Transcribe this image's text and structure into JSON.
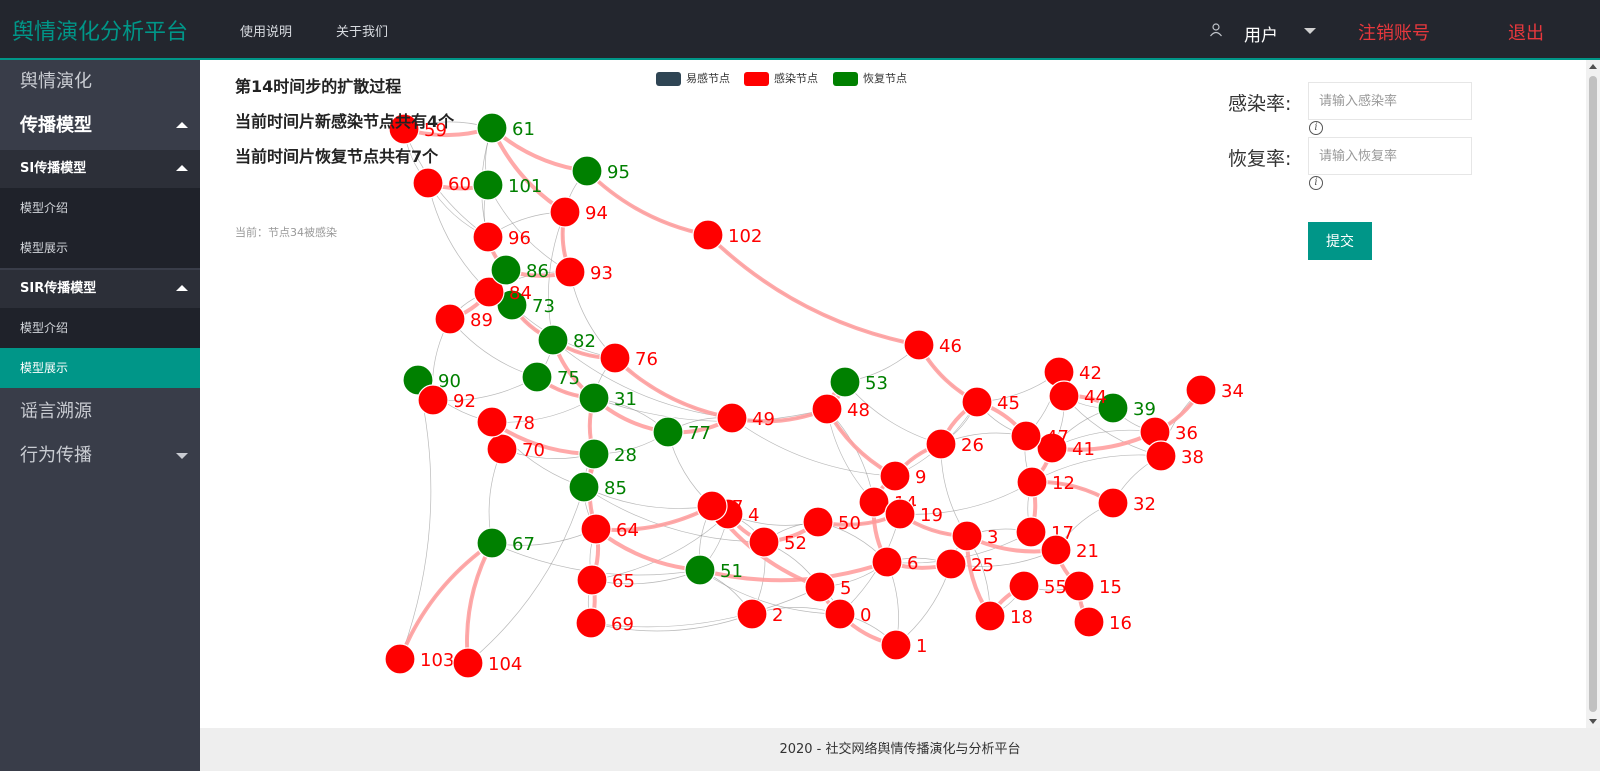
{
  "app": {
    "title": "舆情演化分析平台",
    "nav": [
      "使用说明",
      "关于我们"
    ],
    "user_label": "用户",
    "logout_account": "注销账号",
    "exit": "退出"
  },
  "sidebar": {
    "items": [
      {
        "label": "舆情演化"
      },
      {
        "label": "传播模型"
      },
      {
        "label": "SI传播模型"
      },
      {
        "label": "模型介绍"
      },
      {
        "label": "模型展示"
      },
      {
        "label": "SIR传播模型"
      },
      {
        "label": "模型介绍"
      },
      {
        "label": "模型展示"
      },
      {
        "label": "谣言溯源"
      },
      {
        "label": "行为传播"
      }
    ]
  },
  "main": {
    "step_text": "第14时间步的扩散过程",
    "new_infected_text": "当前时间片新感染节点共有4个",
    "new_recovered_text": "当前时间片恢复节点共有7个",
    "current_text": "当前：节点34被感染",
    "legend": [
      {
        "label": "易感节点",
        "color": "#2f4554"
      },
      {
        "label": "感染节点",
        "color": "#ff0000"
      },
      {
        "label": "恢复节点",
        "color": "#008000"
      }
    ],
    "form": {
      "infect_label": "感染率:",
      "infect_placeholder": "请输入感染率",
      "recover_label": "恢复率:",
      "recover_placeholder": "请输入恢复率",
      "submit_label": "提交"
    }
  },
  "footer": {
    "text": "2020 - 社交网络舆情传播演化与分析平台"
  },
  "colors": {
    "accent": "#009688",
    "infected": "#ff0000",
    "recovered": "#008000",
    "danger": "#e8383d"
  },
  "chart_data": {
    "type": "network",
    "nodes": [
      {
        "id": "0",
        "state": "infected"
      },
      {
        "id": "1",
        "state": "infected"
      },
      {
        "id": "2",
        "state": "infected"
      },
      {
        "id": "3",
        "state": "infected"
      },
      {
        "id": "4",
        "state": "infected"
      },
      {
        "id": "5",
        "state": "infected"
      },
      {
        "id": "6",
        "state": "infected"
      },
      {
        "id": "7",
        "state": "infected"
      },
      {
        "id": "9",
        "state": "infected"
      },
      {
        "id": "12",
        "state": "infected"
      },
      {
        "id": "14",
        "state": "infected"
      },
      {
        "id": "15",
        "state": "infected"
      },
      {
        "id": "16",
        "state": "infected"
      },
      {
        "id": "17",
        "state": "infected"
      },
      {
        "id": "18",
        "state": "infected"
      },
      {
        "id": "19",
        "state": "infected"
      },
      {
        "id": "21",
        "state": "infected"
      },
      {
        "id": "25",
        "state": "infected"
      },
      {
        "id": "26",
        "state": "infected"
      },
      {
        "id": "28",
        "state": "recovered"
      },
      {
        "id": "31",
        "state": "recovered"
      },
      {
        "id": "32",
        "state": "infected"
      },
      {
        "id": "34",
        "state": "infected"
      },
      {
        "id": "36",
        "state": "infected"
      },
      {
        "id": "38",
        "state": "infected"
      },
      {
        "id": "39",
        "state": "recovered"
      },
      {
        "id": "41",
        "state": "infected"
      },
      {
        "id": "42",
        "state": "infected"
      },
      {
        "id": "44",
        "state": "infected"
      },
      {
        "id": "45",
        "state": "infected"
      },
      {
        "id": "46",
        "state": "infected"
      },
      {
        "id": "47",
        "state": "infected"
      },
      {
        "id": "48",
        "state": "infected"
      },
      {
        "id": "49",
        "state": "infected"
      },
      {
        "id": "50",
        "state": "infected"
      },
      {
        "id": "51",
        "state": "recovered"
      },
      {
        "id": "52",
        "state": "infected"
      },
      {
        "id": "53",
        "state": "recovered"
      },
      {
        "id": "55",
        "state": "infected"
      },
      {
        "id": "59",
        "state": "infected"
      },
      {
        "id": "60",
        "state": "infected"
      },
      {
        "id": "61",
        "state": "recovered"
      },
      {
        "id": "64",
        "state": "infected"
      },
      {
        "id": "65",
        "state": "infected"
      },
      {
        "id": "67",
        "state": "recovered"
      },
      {
        "id": "69",
        "state": "infected"
      },
      {
        "id": "70",
        "state": "infected"
      },
      {
        "id": "73",
        "state": "recovered"
      },
      {
        "id": "75",
        "state": "recovered"
      },
      {
        "id": "76",
        "state": "infected"
      },
      {
        "id": "77",
        "state": "recovered"
      },
      {
        "id": "78",
        "state": "infected"
      },
      {
        "id": "82",
        "state": "recovered"
      },
      {
        "id": "84",
        "state": "infected"
      },
      {
        "id": "85",
        "state": "recovered"
      },
      {
        "id": "86",
        "state": "recovered"
      },
      {
        "id": "89",
        "state": "infected"
      },
      {
        "id": "90",
        "state": "recovered"
      },
      {
        "id": "92",
        "state": "infected"
      },
      {
        "id": "93",
        "state": "infected"
      },
      {
        "id": "94",
        "state": "infected"
      },
      {
        "id": "95",
        "state": "recovered"
      },
      {
        "id": "96",
        "state": "infected"
      },
      {
        "id": "101",
        "state": "recovered"
      },
      {
        "id": "102",
        "state": "infected"
      },
      {
        "id": "103",
        "state": "infected"
      },
      {
        "id": "104",
        "state": "infected"
      }
    ]
  }
}
